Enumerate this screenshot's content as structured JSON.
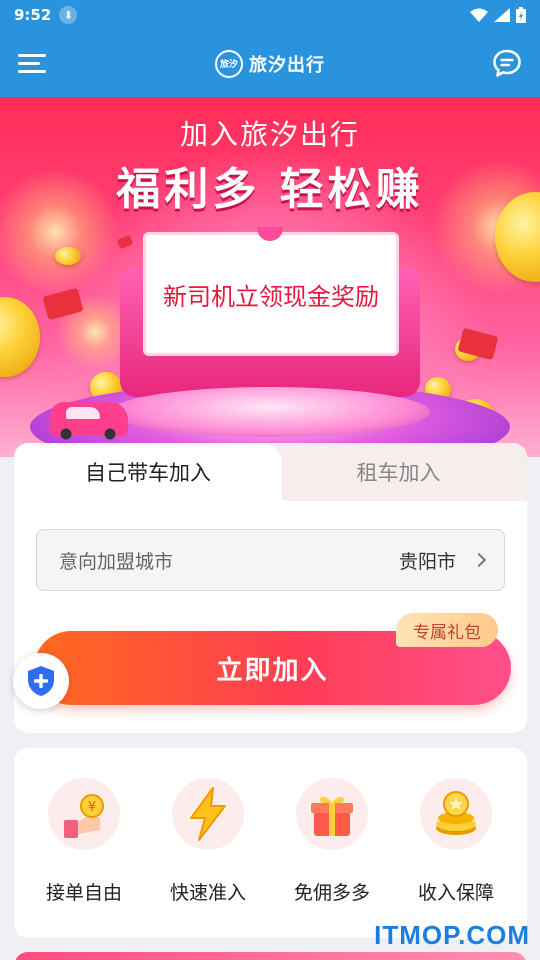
{
  "status_bar": {
    "time": "9:52"
  },
  "header": {
    "brand_name": "旅汐出行",
    "logo_text": "旅汐"
  },
  "hero": {
    "subtitle": "加入旅汐出行",
    "title": "福利多 轻松赚",
    "board_text": "新司机立领现金奖励"
  },
  "join": {
    "tabs": [
      {
        "label": "自己带车加入",
        "active": true
      },
      {
        "label": "租车加入",
        "active": false
      }
    ],
    "city_label": "意向加盟城市",
    "city_value": "贵阳市",
    "gift_tag": "专属礼包",
    "join_button": "立即加入"
  },
  "features": [
    {
      "label": "接单自由",
      "icon": "hand-coin-icon"
    },
    {
      "label": "快速准入",
      "icon": "lightning-icon"
    },
    {
      "label": "免佣多多",
      "icon": "gift-box-icon"
    },
    {
      "label": "收入保障",
      "icon": "coin-stack-icon"
    }
  ],
  "watermark": "ITMOP.COM",
  "colors": {
    "header": "#2a93dd",
    "primary_red": "#ff3d55",
    "accent_orange": "#ff6a1f"
  }
}
